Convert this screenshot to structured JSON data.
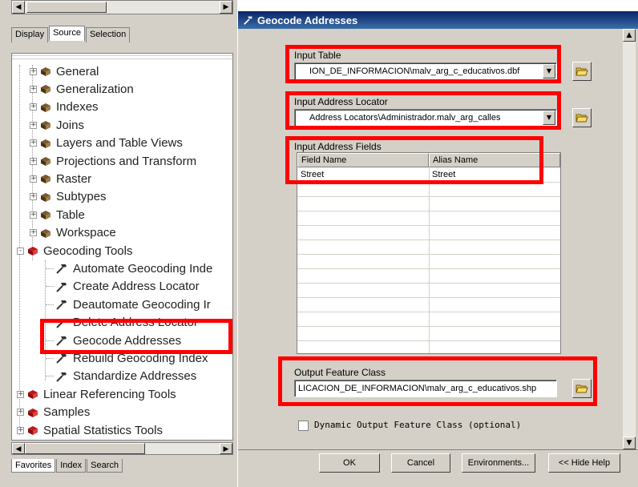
{
  "left_panel": {
    "top_tabs": [
      "Display",
      "Source",
      "Selection"
    ],
    "tree_items": [
      {
        "label": "General",
        "kind": "toolbox",
        "expander": "+",
        "level": 1
      },
      {
        "label": "Generalization",
        "kind": "toolbox",
        "expander": "+",
        "level": 1
      },
      {
        "label": "Indexes",
        "kind": "toolbox",
        "expander": "+",
        "level": 1
      },
      {
        "label": "Joins",
        "kind": "toolbox",
        "expander": "+",
        "level": 1
      },
      {
        "label": "Layers and Table Views",
        "kind": "toolbox",
        "expander": "+",
        "level": 1
      },
      {
        "label": "Projections and Transform",
        "kind": "toolbox",
        "expander": "+",
        "level": 1
      },
      {
        "label": "Raster",
        "kind": "toolbox",
        "expander": "+",
        "level": 1
      },
      {
        "label": "Subtypes",
        "kind": "toolbox",
        "expander": "+",
        "level": 1
      },
      {
        "label": "Table",
        "kind": "toolbox",
        "expander": "+",
        "level": 1
      },
      {
        "label": "Workspace",
        "kind": "toolbox",
        "expander": "+",
        "level": 1
      },
      {
        "label": "Geocoding Tools",
        "kind": "toolbox-red",
        "expander": "-",
        "level": 0
      },
      {
        "label": "Automate Geocoding Inde",
        "kind": "tool",
        "level": 1
      },
      {
        "label": "Create Address Locator",
        "kind": "tool",
        "level": 1
      },
      {
        "label": "Deautomate Geocoding Ir",
        "kind": "tool",
        "level": 1
      },
      {
        "label": "Delete Address Locator",
        "kind": "tool",
        "level": 1
      },
      {
        "label": "Geocode Addresses",
        "kind": "tool",
        "level": 1
      },
      {
        "label": "Rebuild Geocoding Index",
        "kind": "tool",
        "level": 1
      },
      {
        "label": "Standardize Addresses",
        "kind": "tool",
        "level": 1
      },
      {
        "label": "Linear Referencing Tools",
        "kind": "toolbox-red",
        "expander": "+",
        "level": 0
      },
      {
        "label": "Samples",
        "kind": "toolbox-red",
        "expander": "+",
        "level": 0
      },
      {
        "label": "Spatial Statistics Tools",
        "kind": "toolbox-red",
        "expander": "+",
        "level": 0
      }
    ],
    "bottom_tabs": [
      "Favorites",
      "Index",
      "Search"
    ]
  },
  "dialog": {
    "title": "Geocode Addresses",
    "input_table": {
      "label": "Input Table",
      "value": "ION_DE_INFORMACION\\malv_arg_c_educativos.dbf"
    },
    "address_locator": {
      "label": "Input Address Locator",
      "value": "Address Locators\\Administrador.malv_arg_calles"
    },
    "address_fields": {
      "label": "Input Address Fields",
      "columns": [
        "Field Name",
        "Alias Name"
      ],
      "rows": [
        [
          "Street",
          "Street"
        ]
      ]
    },
    "output": {
      "label": "Output Feature Class",
      "value": "LICACION_DE_INFORMACION\\malv_arg_c_educativos.shp"
    },
    "dynamic_output": {
      "label": "Dynamic Output Feature Class (optional)",
      "checked": false
    },
    "buttons": {
      "ok": "OK",
      "cancel": "Cancel",
      "environments": "Environments...",
      "hide_help": "<< Hide Help"
    }
  },
  "colors": {
    "highlight": "#ff0000",
    "title_start": "#0a246a",
    "title_end": "#3a6ea5",
    "face": "#d4d0c8"
  },
  "icons": {
    "toolbox": "toolbox-icon",
    "tool": "hammer-icon",
    "browse": "open-folder-icon",
    "dropdown": "chevron-down-icon"
  }
}
